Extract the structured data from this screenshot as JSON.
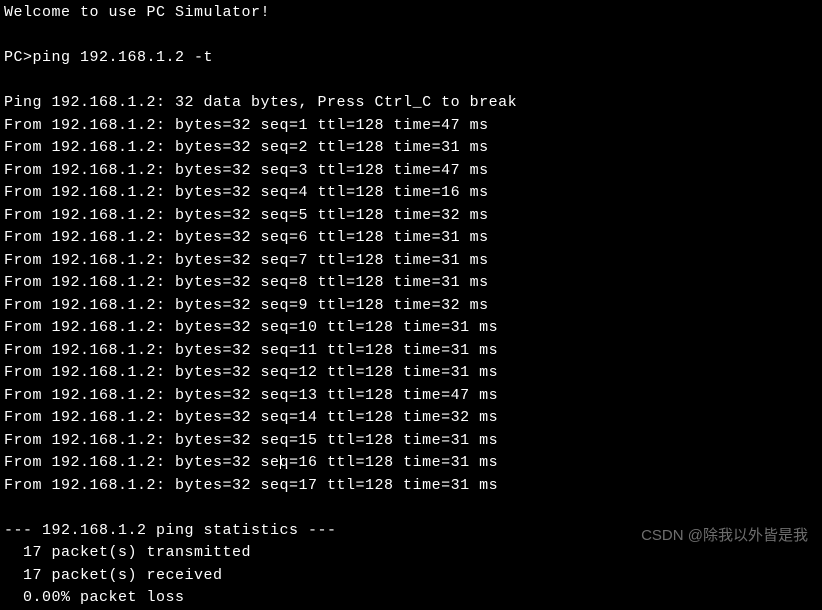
{
  "terminal": {
    "welcome": "Welcome to use PC Simulator!",
    "prompt": "PC>",
    "command": "ping 192.168.1.2 -t",
    "header": "Ping 192.168.1.2: 32 data bytes, Press Ctrl_C to break",
    "host": "192.168.1.2",
    "replies": [
      {
        "seq": 1,
        "bytes": 32,
        "ttl": 128,
        "time": 47
      },
      {
        "seq": 2,
        "bytes": 32,
        "ttl": 128,
        "time": 31
      },
      {
        "seq": 3,
        "bytes": 32,
        "ttl": 128,
        "time": 47
      },
      {
        "seq": 4,
        "bytes": 32,
        "ttl": 128,
        "time": 16
      },
      {
        "seq": 5,
        "bytes": 32,
        "ttl": 128,
        "time": 32
      },
      {
        "seq": 6,
        "bytes": 32,
        "ttl": 128,
        "time": 31
      },
      {
        "seq": 7,
        "bytes": 32,
        "ttl": 128,
        "time": 31
      },
      {
        "seq": 8,
        "bytes": 32,
        "ttl": 128,
        "time": 31
      },
      {
        "seq": 9,
        "bytes": 32,
        "ttl": 128,
        "time": 32
      },
      {
        "seq": 10,
        "bytes": 32,
        "ttl": 128,
        "time": 31
      },
      {
        "seq": 11,
        "bytes": 32,
        "ttl": 128,
        "time": 31
      },
      {
        "seq": 12,
        "bytes": 32,
        "ttl": 128,
        "time": 31
      },
      {
        "seq": 13,
        "bytes": 32,
        "ttl": 128,
        "time": 47
      },
      {
        "seq": 14,
        "bytes": 32,
        "ttl": 128,
        "time": 32
      },
      {
        "seq": 15,
        "bytes": 32,
        "ttl": 128,
        "time": 31
      },
      {
        "seq": 16,
        "bytes": 32,
        "ttl": 128,
        "time": 31
      },
      {
        "seq": 17,
        "bytes": 32,
        "ttl": 128,
        "time": 31
      }
    ],
    "stats": {
      "header": "--- 192.168.1.2 ping statistics ---",
      "transmitted": "  17 packet(s) transmitted",
      "received": "  17 packet(s) received",
      "loss": "  0.00% packet loss"
    }
  },
  "watermark": "CSDN @除我以外皆是我"
}
